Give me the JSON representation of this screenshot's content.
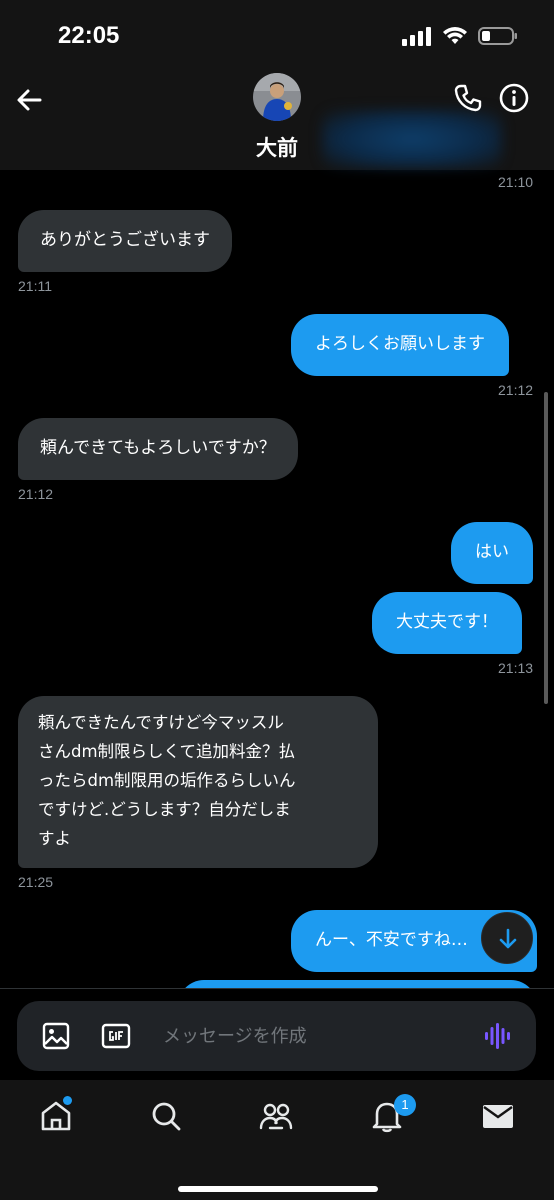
{
  "status_bar": {
    "time": "22:05"
  },
  "header": {
    "contact_name": "大前"
  },
  "messages": [
    {
      "direction": "time",
      "time": "21:10"
    },
    {
      "direction": "in",
      "text": "ありがとうございます",
      "time": "21:11"
    },
    {
      "direction": "out",
      "text": "よろしくお願いします",
      "time": "21:12"
    },
    {
      "direction": "in",
      "text": "頼んできてもよろしいですか？",
      "time": "21:12"
    },
    {
      "direction": "out",
      "text": "はい"
    },
    {
      "direction": "out",
      "text": "大丈夫です！",
      "time": "21:13"
    },
    {
      "direction": "in",
      "text": "頼んできたんですけど今マッスル\nさんdm制限らしくて追加料金？払\nったらdm制限用の垢作るらしいん\nですけど.どうします？自分だしま\nすよ",
      "time": "21:25"
    },
    {
      "direction": "out",
      "text": "んー、不安ですね…"
    }
  ],
  "composer": {
    "placeholder": "メッセージを作成"
  },
  "tabbar": {
    "notification_count": "1"
  },
  "colors": {
    "accent": "#1d9bf0",
    "incoming_bubble": "#2f3336",
    "background": "#000000",
    "voice_icon": "#7856ff"
  }
}
